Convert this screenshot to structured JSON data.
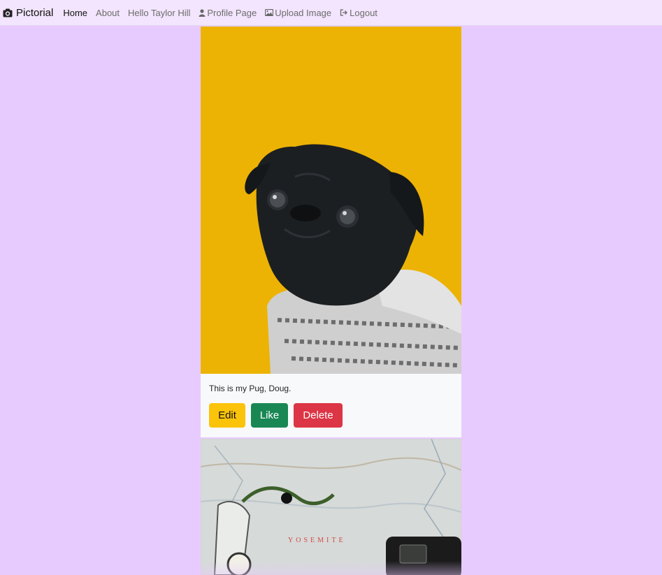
{
  "navbar": {
    "brand": "Pictorial",
    "brand_icon": "camera-icon",
    "links": [
      {
        "label": "Home",
        "active": true
      },
      {
        "label": "About"
      },
      {
        "label": "Hello Taylor Hill"
      },
      {
        "label": "Profile Page",
        "icon": "user-icon"
      },
      {
        "label": "Upload Image",
        "icon": "image-icon"
      },
      {
        "label": "Logout",
        "icon": "logout-icon"
      }
    ]
  },
  "posts": [
    {
      "image": "pug-photo",
      "caption": "This is my Pug, Doug.",
      "buttons": {
        "edit": "Edit",
        "like": "Like",
        "delete": "Delete"
      }
    },
    {
      "image": "map-photo",
      "map_label": "YOSEMITE"
    }
  ],
  "colors": {
    "page_bg": "#e8cbfe",
    "navbar_bg": "#f2e5fd",
    "edit": "#fbc30a",
    "like": "#198754",
    "delete": "#dc3545",
    "pug_bg": "#ecb304"
  }
}
